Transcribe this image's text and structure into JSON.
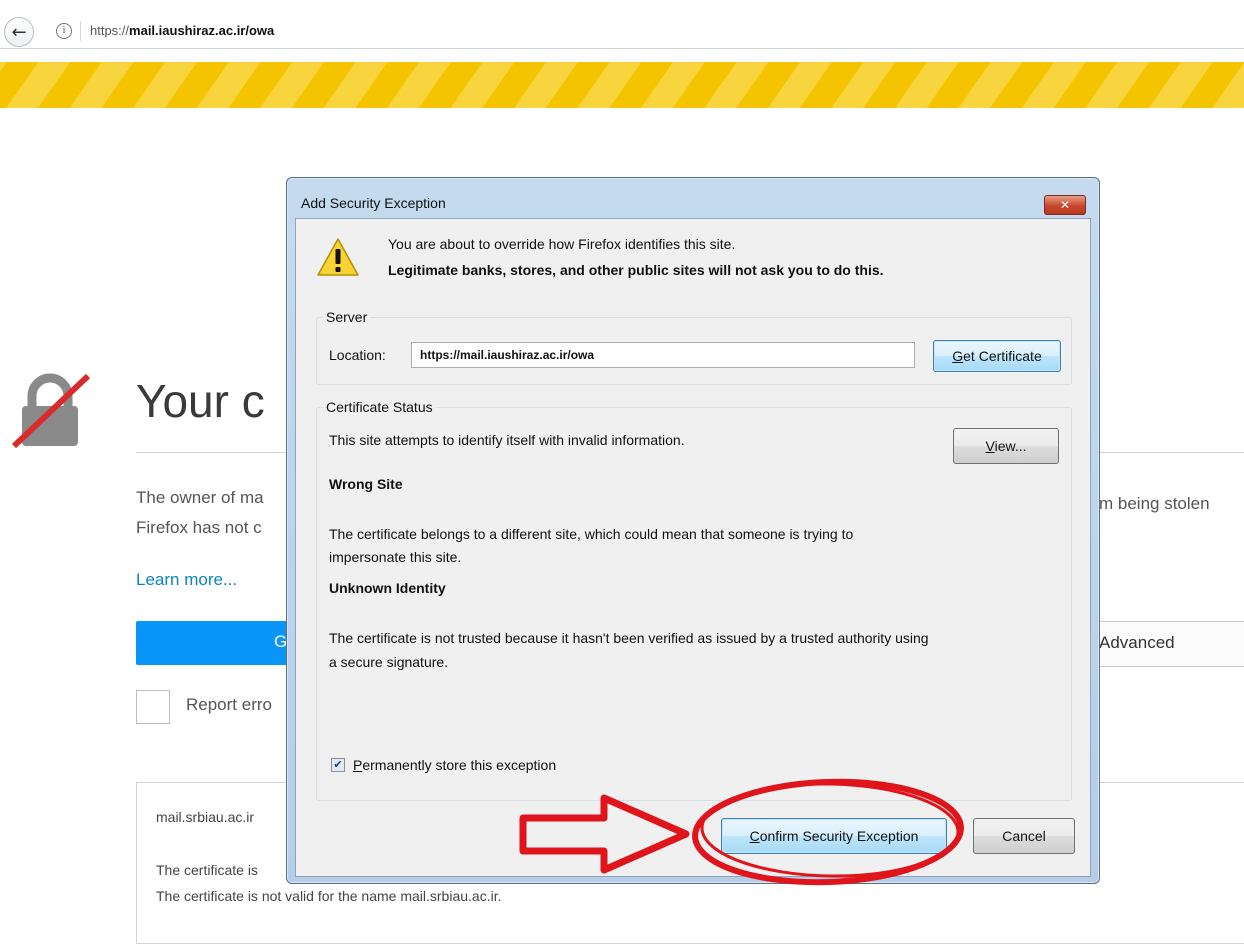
{
  "browser": {
    "url_prefix": "https://",
    "url_host": "mail.iaushiraz.ac.ir/owa",
    "info_glyph": "i",
    "back_glyph": "←"
  },
  "error_page": {
    "title": "Your c",
    "paragraph_line1": "The owner of ma",
    "paragraph_line2": "Firefox has not c",
    "paragraph_right": "m being stolen",
    "learn_more": "Learn more...",
    "go_back_label": "G",
    "advanced_label": "Advanced",
    "report_label": "Report erro",
    "details": {
      "host": "mail.srbiau.ac.ir",
      "line1": "The certificate is",
      "line2": "The certificate is not valid for the name mail.srbiau.ac.ir."
    }
  },
  "dialog": {
    "title": "Add Security Exception",
    "close_glyph": "✕",
    "warning_line1": "You are about to override how Firefox identifies this site.",
    "warning_line2": "Legitimate banks, stores, and other public sites will not ask you to do this.",
    "server": {
      "legend": "Server",
      "location_label": "Location:",
      "location_value": "https://mail.iaushiraz.ac.ir/owa",
      "get_certificate_prefix": "G",
      "get_certificate_rest": "et Certificate"
    },
    "status": {
      "legend": "Certificate Status",
      "intro": "This site attempts to identify itself with invalid information.",
      "view_prefix": "V",
      "view_rest": "iew...",
      "wrong_site_heading": "Wrong Site",
      "wrong_site_line1": "The certificate belongs to a different site, which could mean that someone is trying to",
      "wrong_site_line2": "impersonate this site.",
      "unknown_identity_heading": "Unknown Identity",
      "unknown_identity_line1": "The certificate is not trusted because it hasn't been verified as issued by a trusted authority using",
      "unknown_identity_line2": "a secure signature.",
      "permanent_prefix": "P",
      "permanent_rest": "ermanently store this exception",
      "permanent_checked_glyph": "✔"
    },
    "confirm_prefix": "C",
    "confirm_rest": "onfirm Security Exception",
    "cancel_label": "Cancel"
  },
  "colors": {
    "annotation_red": "#e0141b",
    "firefox_blue": "#0996f8",
    "warning_yellow": "#f5c400"
  }
}
